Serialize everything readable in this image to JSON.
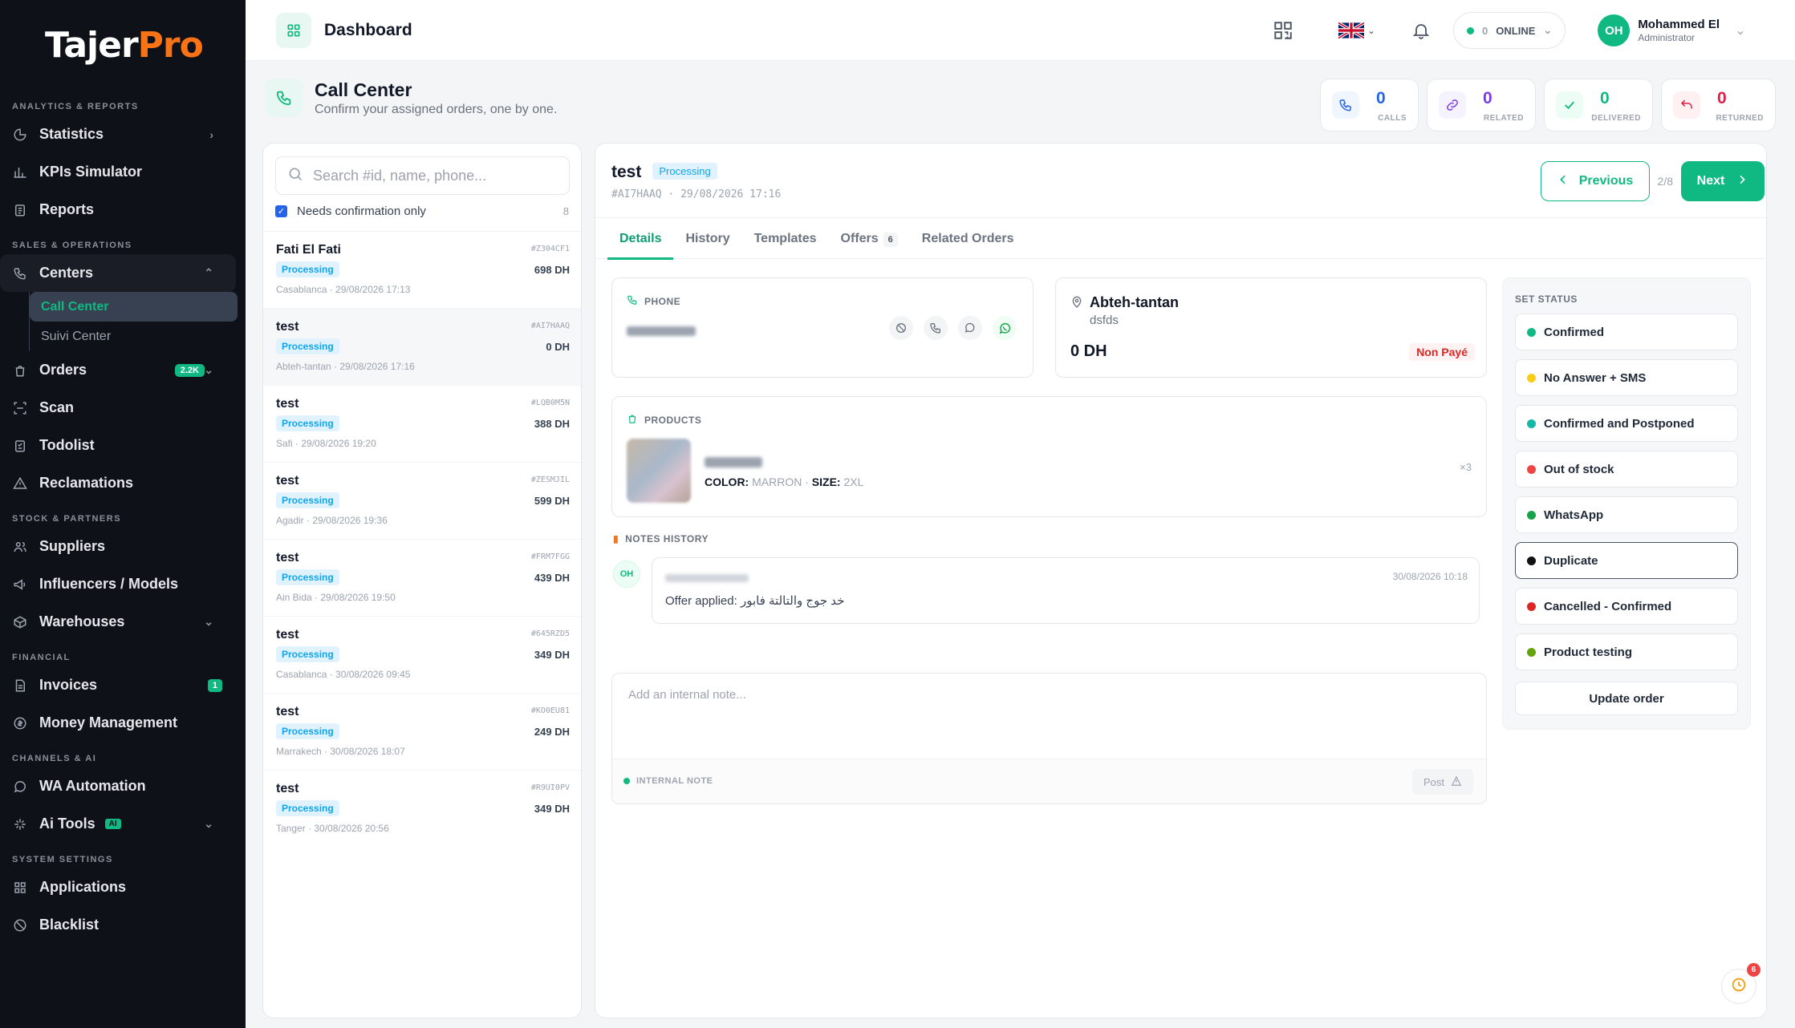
{
  "brand": {
    "logo_a": "Tajer",
    "logo_b": "Pro"
  },
  "sidebar": {
    "sec_analytics": "ANALYTICS & REPORTS",
    "statistics": "Statistics",
    "kpis": "KPIs Simulator",
    "reports": "Reports",
    "sec_sales": "SALES & OPERATIONS",
    "centers": "Centers",
    "call_center": "Call Center",
    "suivi_center": "Suivi Center",
    "orders": "Orders",
    "orders_badge": "2.2K",
    "scan": "Scan",
    "todolist": "Todolist",
    "reclamations": "Reclamations",
    "sec_stock": "STOCK & PARTNERS",
    "suppliers": "Suppliers",
    "influencers": "Influencers / Models",
    "warehouses": "Warehouses",
    "sec_financial": "FINANCIAL",
    "invoices": "Invoices",
    "invoices_badge": "1",
    "money": "Money Management",
    "sec_channels": "CHANNELS & AI",
    "wa": "WA Automation",
    "ai_tools": "Ai Tools",
    "ai_badge": "AI",
    "sec_system": "SYSTEM SETTINGS",
    "applications": "Applications",
    "blacklist": "Blacklist"
  },
  "topbar": {
    "title": "Dashboard",
    "online_count": "0",
    "online_label": "ONLINE",
    "user_initials": "OH",
    "user_name": "Mohammed El",
    "user_role": "Administrator"
  },
  "page": {
    "title": "Call Center",
    "subtitle": "Confirm your assigned orders, one by one."
  },
  "stats": [
    {
      "value": "0",
      "label": "CALLS",
      "color": "#2563eb"
    },
    {
      "value": "0",
      "label": "RELATED",
      "color": "#7c3aed"
    },
    {
      "value": "0",
      "label": "DELIVERED",
      "color": "#10b981"
    },
    {
      "value": "0",
      "label": "RETURNED",
      "color": "#e11d48"
    }
  ],
  "list": {
    "search_placeholder": "Search #id, name, phone...",
    "filter_label": "Needs confirmation only",
    "filter_count": "8",
    "rows": [
      {
        "name": "Fati El Fati",
        "status": "Processing",
        "meta": "Casablanca · 29/08/2026 17:13",
        "id": "#Z304CF1",
        "price": "698 DH"
      },
      {
        "name": "test",
        "status": "Processing",
        "meta": "Abteh-tantan · 29/08/2026 17:16",
        "id": "#AI7HAAQ",
        "price": "0 DH"
      },
      {
        "name": "test",
        "status": "Processing",
        "meta": "Safi · 29/08/2026 19:20",
        "id": "#LQB0M5N",
        "price": "388 DH"
      },
      {
        "name": "test",
        "status": "Processing",
        "meta": "Agadir · 29/08/2026 19:36",
        "id": "#ZESMJIL",
        "price": "599 DH"
      },
      {
        "name": "test",
        "status": "Processing",
        "meta": "Ain Bida · 29/08/2026 19:50",
        "id": "#FRM7FGG",
        "price": "439 DH"
      },
      {
        "name": "test",
        "status": "Processing",
        "meta": "Casablanca · 30/08/2026 09:45",
        "id": "#645RZD5",
        "price": "349 DH"
      },
      {
        "name": "test",
        "status": "Processing",
        "meta": "Marrakech · 30/08/2026 18:07",
        "id": "#KO0EU81",
        "price": "249 DH"
      },
      {
        "name": "test",
        "status": "Processing",
        "meta": "Tanger · 30/08/2026 20:56",
        "id": "#R9UI0PV",
        "price": "349 DH"
      }
    ]
  },
  "order": {
    "name": "test",
    "status": "Processing",
    "meta": "#AI7HAAQ · 29/08/2026 17:16",
    "prev": "Previous",
    "pager": "2/8",
    "next": "Next",
    "tabs": {
      "details": "Details",
      "history": "History",
      "templates": "Templates",
      "offers": "Offers",
      "offers_count": "6",
      "related": "Related Orders"
    },
    "phone_label": "PHONE",
    "city": "Abteh-tantan",
    "address": "dsfds",
    "total": "0 DH",
    "payment": "Non Payé",
    "products_label": "PRODUCTS",
    "color_label": "COLOR:",
    "color_value": "MARRON",
    "size_label": "SIZE:",
    "size_value": "2XL",
    "qty": "×3",
    "notes_label": "NOTES HISTORY",
    "note_initials": "OH",
    "note_time": "30/08/2026 10:18",
    "note_text": "Offer applied: خد جوج والتالتة فابور",
    "note_placeholder": "Add an internal note...",
    "internal_label": "INTERNAL NOTE",
    "post": "Post"
  },
  "status": {
    "title": "SET STATUS",
    "options": [
      {
        "label": "Confirmed",
        "color": "#10b981"
      },
      {
        "label": "No Answer + SMS",
        "color": "#facc15"
      },
      {
        "label": "Confirmed and Postponed",
        "color": "#14b8a6"
      },
      {
        "label": "Out of stock",
        "color": "#ef4444"
      },
      {
        "label": "WhatsApp",
        "color": "#16a34a"
      },
      {
        "label": "Duplicate",
        "color": "#111111"
      },
      {
        "label": "Cancelled - Confirmed",
        "color": "#dc2626"
      },
      {
        "label": "Product testing",
        "color": "#65a30d"
      }
    ],
    "update": "Update order"
  },
  "fab_badge": "6"
}
